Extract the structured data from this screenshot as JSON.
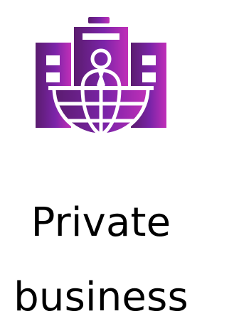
{
  "icon": {
    "name": "business-globe-icon",
    "colors": {
      "dark": "#5a1c6e",
      "mid": "#7b24a8",
      "light": "#c12fb8"
    }
  },
  "title": {
    "line1": "Private",
    "line2": "business"
  }
}
